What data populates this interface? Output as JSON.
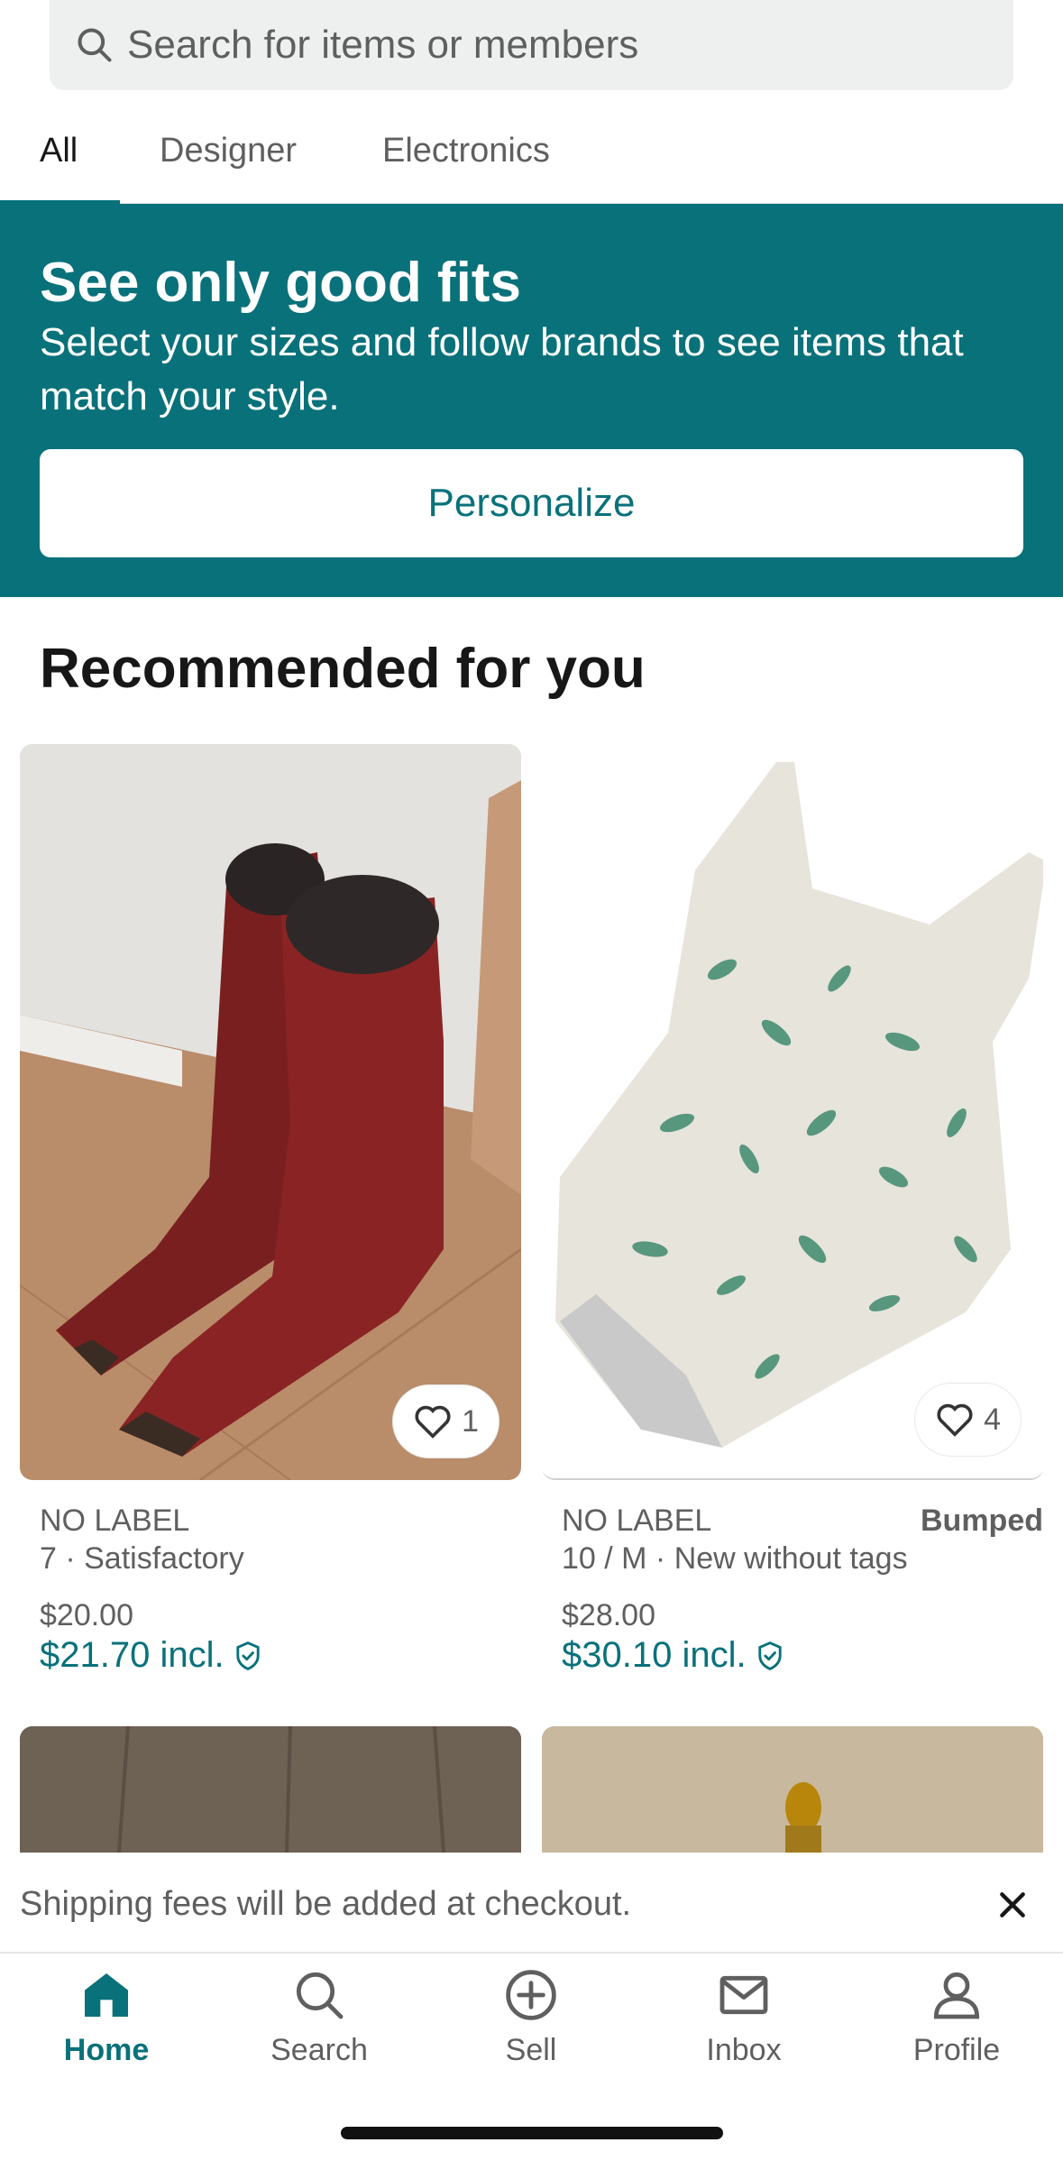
{
  "search": {
    "placeholder": "Search for items or members"
  },
  "tabs": [
    {
      "label": "All",
      "active": true
    },
    {
      "label": "Designer",
      "active": false
    },
    {
      "label": "Electronics",
      "active": false
    }
  ],
  "banner": {
    "title": "See only good fits",
    "subtitle": "Select your sizes and follow brands to see items that match your style.",
    "button_label": "Personalize"
  },
  "recommended": {
    "title": "Recommended for you",
    "items": [
      {
        "brand": "NO LABEL",
        "meta": "7 · Satisfactory",
        "price": "$20.00",
        "price_incl": "$21.70 incl.",
        "likes": "1",
        "badge": "",
        "image": "red cowboy boots"
      },
      {
        "brand": "NO LABEL",
        "meta": "10 / M · New without tags",
        "price": "$28.00",
        "price_incl": "$30.10 incl.",
        "likes": "4",
        "badge": "Bumped",
        "image": "floral one-piece swimsuit"
      }
    ]
  },
  "shipping_note": {
    "text": "Shipping fees will be added at checkout."
  },
  "nav": [
    {
      "label": "Home",
      "icon": "home-icon",
      "active": true
    },
    {
      "label": "Search",
      "icon": "search-icon",
      "active": false
    },
    {
      "label": "Sell",
      "icon": "plus-circle-icon",
      "active": false
    },
    {
      "label": "Inbox",
      "icon": "mail-icon",
      "active": false
    },
    {
      "label": "Profile",
      "icon": "person-icon",
      "active": false
    }
  ],
  "colors": {
    "accent": "#09717a",
    "text": "#171717",
    "muted": "#5f5f5f"
  }
}
